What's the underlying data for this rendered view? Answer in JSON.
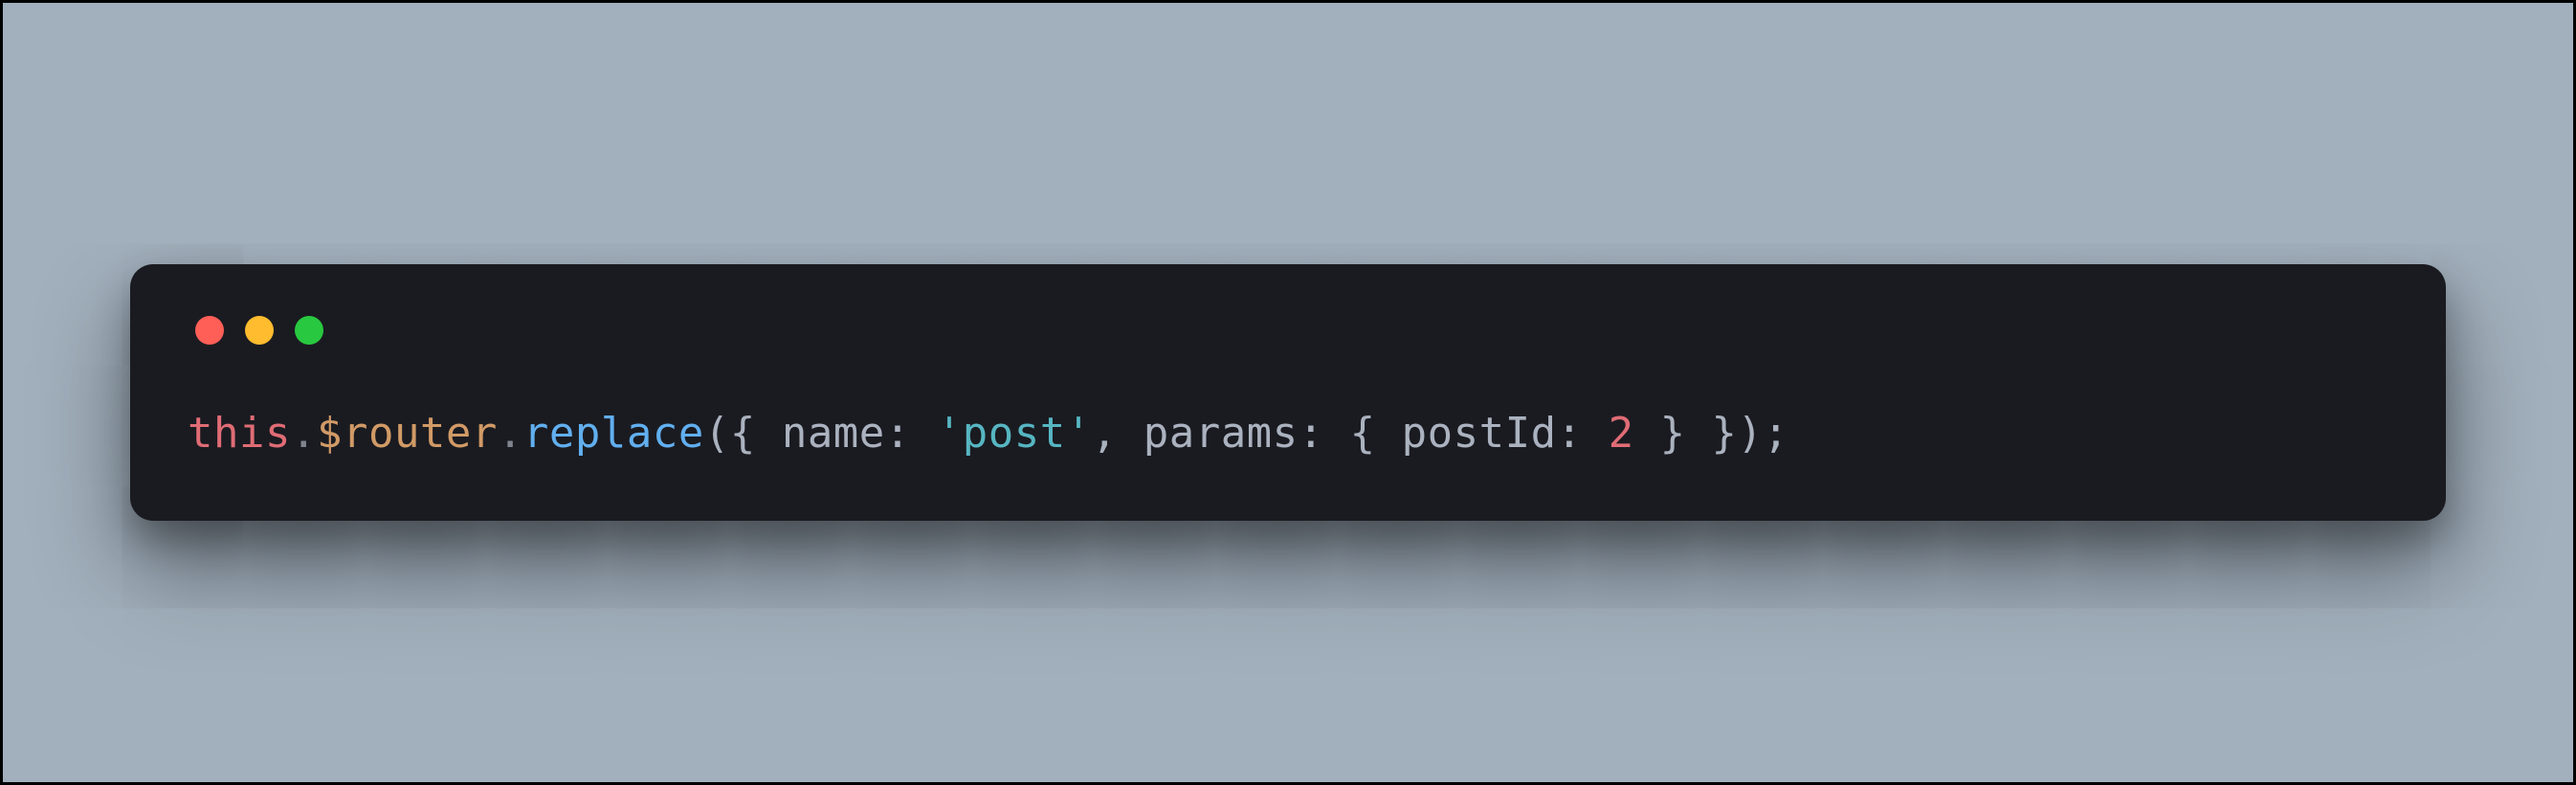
{
  "traffic": {
    "red": "#ff5f57",
    "yellow": "#febc2e",
    "green": "#28c840"
  },
  "code": {
    "t_this": "this",
    "dot1": ".",
    "prop_router": "$router",
    "dot2": ".",
    "method_replace": "replace",
    "paren_open": "(",
    "brace1_open": "{ ",
    "key_name": "name",
    "colon1": ": ",
    "str_post": "'post'",
    "comma1": ", ",
    "key_params": "params",
    "colon2": ": ",
    "brace2_open": "{ ",
    "key_postId": "postId",
    "colon3": ": ",
    "num_2": "2",
    "brace2_close": " }",
    "brace1_close": " }",
    "paren_close": ")",
    "semi": ";"
  }
}
